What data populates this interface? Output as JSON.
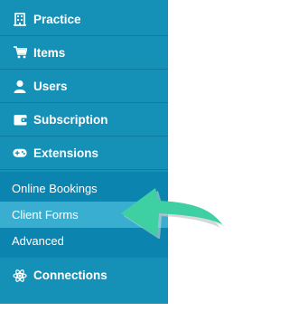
{
  "menu": {
    "items": [
      {
        "label": "Practice",
        "icon": "building-icon"
      },
      {
        "label": "Items",
        "icon": "cart-icon"
      },
      {
        "label": "Users",
        "icon": "user-icon"
      },
      {
        "label": "Subscription",
        "icon": "wallet-icon"
      },
      {
        "label": "Extensions",
        "icon": "gamepad-icon"
      }
    ],
    "submenu": [
      {
        "label": "Online Bookings"
      },
      {
        "label": "Client Forms",
        "active": true
      },
      {
        "label": "Advanced"
      }
    ],
    "bottom": {
      "label": "Connections",
      "icon": "atom-icon"
    }
  },
  "colors": {
    "sidebar": "#1591b8",
    "submenu": "#0c84b0",
    "active": "#3aaed0",
    "arrow": "#3ecfa2"
  }
}
